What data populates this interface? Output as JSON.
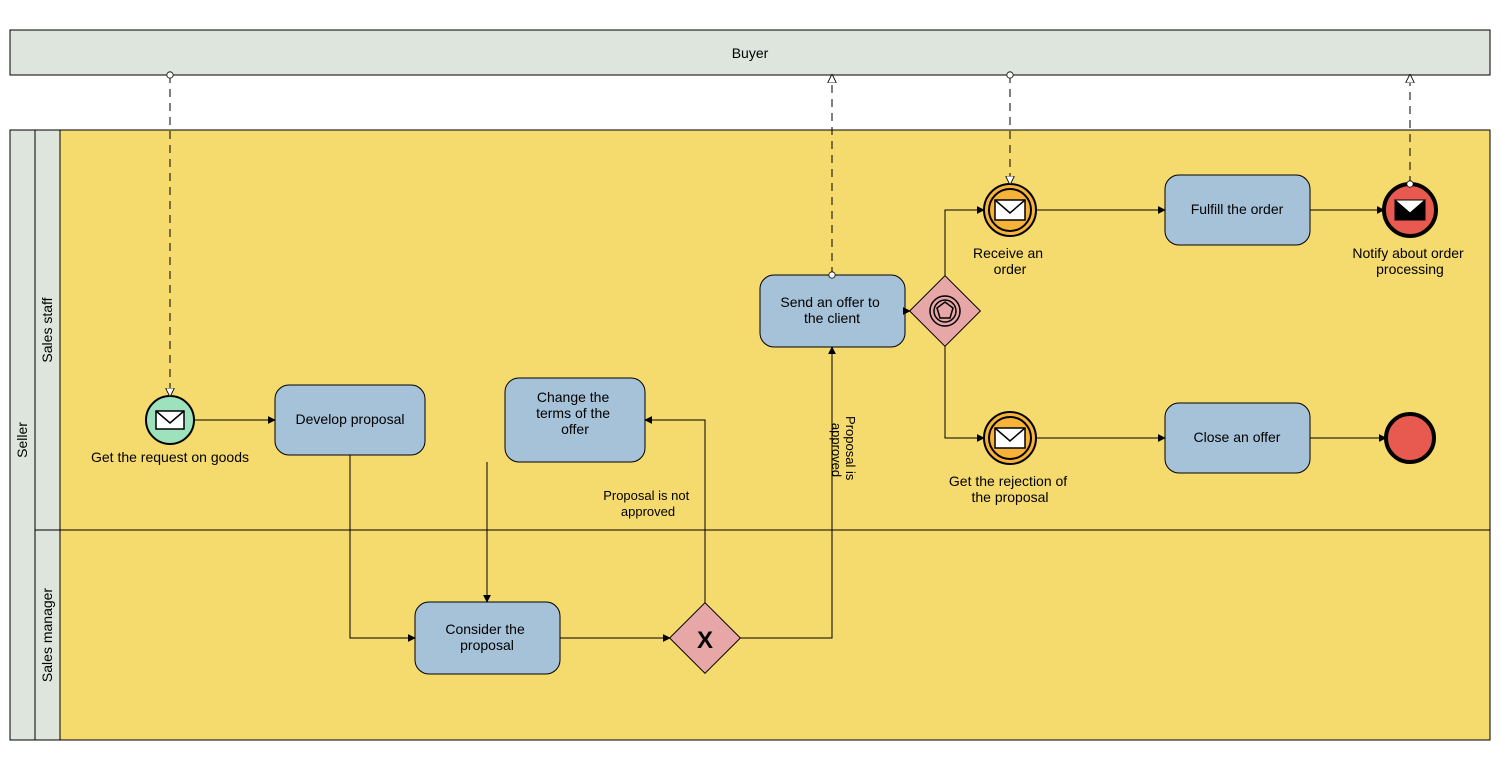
{
  "pools": {
    "buyer": "Buyer",
    "seller": "Seller"
  },
  "lanes": {
    "salesStaff": "Sales staff",
    "salesManager": "Sales manager"
  },
  "tasks": {
    "develop": "Develop proposal",
    "change": "Change the\nterms of the\noffer",
    "consider": "Consider the\nproposal",
    "send": "Send an offer to\nthe client",
    "fulfill": "Fulfill the order",
    "close": "Close an offer"
  },
  "events": {
    "start": "Get the request on goods",
    "receive": "Receive an\norder",
    "reject": "Get the rejection of\nthe proposal",
    "notify": "Notify about order\nprocessing"
  },
  "flowLabels": {
    "approved": "Proposal is\napproved",
    "notApproved": "Proposal is not\napproved"
  }
}
